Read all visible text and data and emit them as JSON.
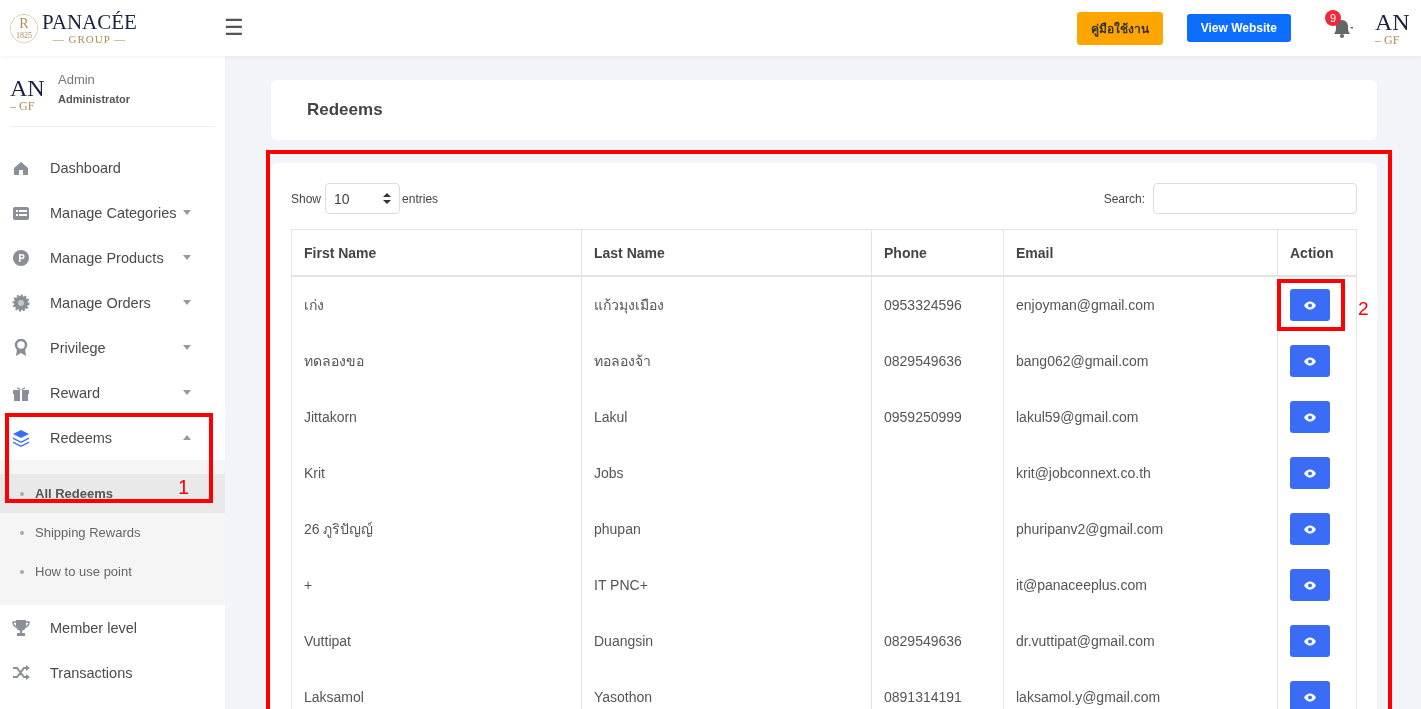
{
  "header": {
    "logo": {
      "monogram": "R",
      "year": "1825",
      "name": "PANACÉE",
      "tagline": "— GROUP —"
    },
    "menu_icon": "☰",
    "buttons": [
      {
        "label": "คู่มือใช้งาน",
        "kind": "warning"
      },
      {
        "label": "View Website",
        "kind": "primary"
      }
    ],
    "notifications": {
      "count": "9"
    },
    "avatar": {
      "line_1": "AN",
      "line_2": "– GF"
    }
  },
  "sidebar": {
    "user": {
      "avatar": {
        "line_1": "AN",
        "line_2": "– GF"
      },
      "name": "Admin",
      "role": "Administrator"
    },
    "items": [
      {
        "label": "Dashboard",
        "has_caret": false
      },
      {
        "label": "Manage Categories",
        "has_caret": true,
        "expanded": false
      },
      {
        "label": "Manage Products",
        "has_caret": true,
        "expanded": false
      },
      {
        "label": "Manage Orders",
        "has_caret": true,
        "expanded": false
      },
      {
        "label": "Privilege",
        "has_caret": true,
        "expanded": false
      },
      {
        "label": "Reward",
        "has_caret": true,
        "expanded": false
      },
      {
        "label": "Redeems",
        "has_caret": true,
        "expanded": true,
        "children": [
          {
            "label": "All Redeems",
            "selected": true
          },
          {
            "label": "Shipping Rewards",
            "selected": false
          },
          {
            "label": "How to use point",
            "selected": false
          }
        ]
      },
      {
        "label": "Member level",
        "has_caret": false
      },
      {
        "label": "Transactions",
        "has_caret": false
      }
    ]
  },
  "page_title": "Redeems",
  "table": {
    "show_label": "Show",
    "page_size": "10",
    "entries_label": "entries",
    "search_label": "Search:",
    "columns": [
      "First Name",
      "Last Name",
      "Phone",
      "Email",
      "Action"
    ],
    "rows": [
      [
        "เก่ง",
        "แก้วมุงเมือง",
        "0953324596",
        "enjoyman@gmail.com"
      ],
      [
        "ทดลองขอ",
        "ทอลองจ้า",
        "0829549636",
        "bang062@gmail.com"
      ],
      [
        "Jittakorn",
        "Lakul",
        "0959250999",
        "lakul59@gmail.com"
      ],
      [
        "Krit",
        "Jobs",
        "",
        "krit@jobconnext.co.th"
      ],
      [
        "26 ภูริปัญญ์",
        "phupan",
        "",
        "phuripanv2@gmail.com"
      ],
      [
        "+",
        "IT PNC+",
        "",
        "it@panaceeplus.com"
      ],
      [
        "Vuttipat",
        "Duangsin",
        "0829549636",
        "dr.vuttipat@gmail.com"
      ],
      [
        "Laksamol",
        "Yasothon",
        "0891314191",
        "laksamol.y@gmail.com"
      ]
    ]
  },
  "annotations": {
    "table_highlight": true,
    "marks": [
      {
        "label": "1"
      },
      {
        "label": "2"
      }
    ]
  }
}
